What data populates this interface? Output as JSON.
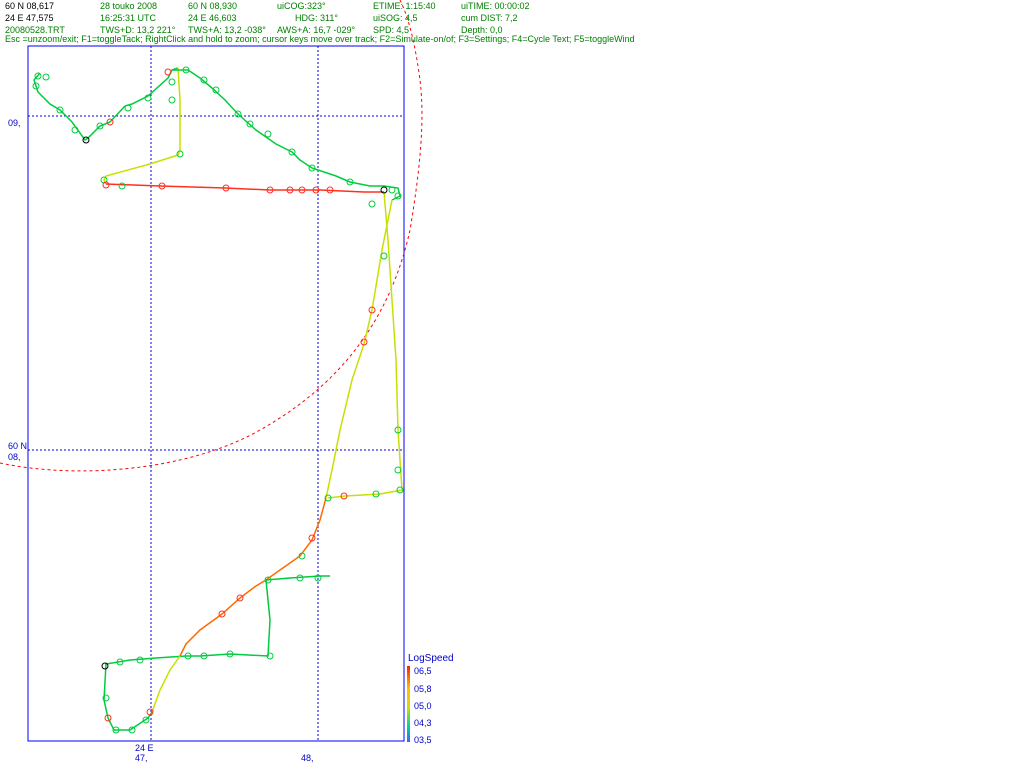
{
  "header": {
    "lat": "60 N 08,617",
    "lon": "24 E 47,575",
    "file": "20080528.TRT",
    "date": "28 touko 2008",
    "time": "16:25:31  UTC",
    "tws_d": "TWS+D: 13,2 221°",
    "cur_lat": "60 N 08,930",
    "cur_lon": "24 E 46,603",
    "tws_a": "TWS+A: 13,2 -038°",
    "uicog": "uiCOG:323°",
    "hdg": "HDG: 311°",
    "aws_a": "AWS+A: 16,7 -029°",
    "etime": "ETIME: 1:15:40",
    "uisog": "uiSOG: 4,5",
    "spd": "SPD: 4,5",
    "uitime": "uiTIME: 00:00:02",
    "cum_dist": "cum DIST: 7,2",
    "depth": "Depth: 0,0",
    "help": "Esc =unzoom/exit; F1=toggleTack; RightClick and hold to zoom; cursor keys move over track; F2=Simulate-on/of; F3=Settings; F4=Cycle Text; F5=toggleWind"
  },
  "axis": {
    "lat_label_09": "09,",
    "lat_label_60n": "60 N",
    "lat_label_08": "08,",
    "lon_label_24e": "24 E",
    "lon_label_47": "47,",
    "lon_label_48": "48,"
  },
  "legend": {
    "title": "LogSpeed",
    "ticks": [
      "06,5",
      "05,8",
      "05,0",
      "04,3",
      "03,5"
    ]
  },
  "colors": {
    "frame": "#0000ff",
    "grid": "#0000cc",
    "circle": "#ff0000",
    "fast": "#ff2000",
    "mid": "#c8e000",
    "slow": "#00cc40"
  }
}
